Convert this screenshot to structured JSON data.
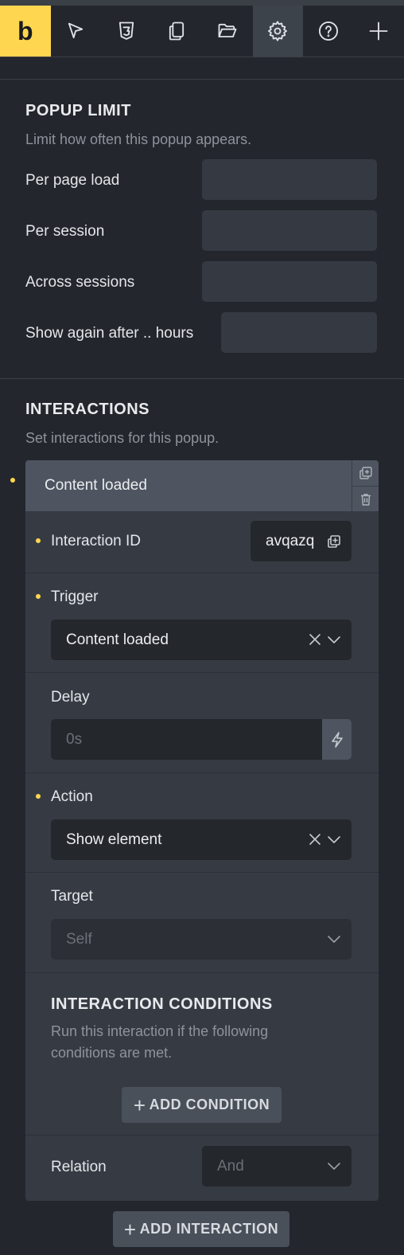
{
  "toolbar": {
    "logo": "b",
    "icons": [
      "cursor-icon",
      "css3-icon",
      "pages-icon",
      "folder-icon",
      "gear-icon",
      "help-icon",
      "plus-icon"
    ]
  },
  "popup_limit": {
    "title": "POPUP LIMIT",
    "description": "Limit how often this popup appears.",
    "rows": [
      {
        "label": "Per page load",
        "value": ""
      },
      {
        "label": "Per session",
        "value": ""
      },
      {
        "label": "Across sessions",
        "value": ""
      },
      {
        "label": "Show again after .. hours",
        "value": ""
      }
    ]
  },
  "interactions": {
    "title": "INTERACTIONS",
    "description": "Set interactions for this popup.",
    "item": {
      "header": "Content loaded",
      "id_label": "Interaction ID",
      "id_value": "avqazq",
      "trigger_label": "Trigger",
      "trigger_value": "Content loaded",
      "delay_label": "Delay",
      "delay_placeholder": "0s",
      "action_label": "Action",
      "action_value": "Show element",
      "target_label": "Target",
      "target_value": "Self",
      "conditions_title": "INTERACTION CONDITIONS",
      "conditions_desc_1": "Run this interaction if the following",
      "conditions_desc_2": "conditions are met.",
      "add_condition": "ADD CONDITION",
      "relation_label": "Relation",
      "relation_value": "And"
    },
    "add_interaction": "ADD INTERACTION"
  },
  "colors": {
    "accent": "#ffd64f",
    "background": "#23262c",
    "panel": "#363b43"
  }
}
